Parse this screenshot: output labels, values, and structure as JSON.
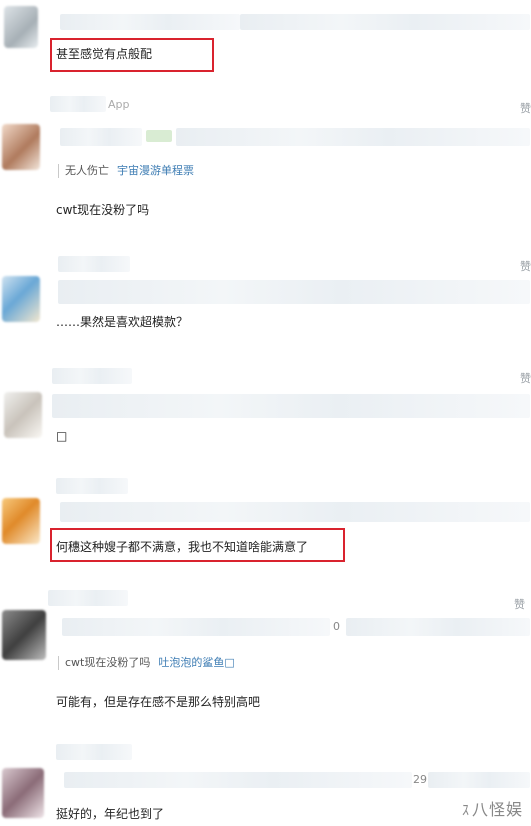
{
  "comments": [
    {
      "text": "甚至感觉有点般配"
    },
    {
      "source": "App",
      "quote_user": "无人伤亡",
      "quote_link": "宇宙漫游单程票",
      "text": "cwt现在没粉了吗"
    },
    {
      "text": "……果然是喜欢超模款？"
    },
    {
      "text": "□"
    },
    {
      "text": "何穗这种嫂子都不满意，我也不知道啥能满意了"
    },
    {
      "meta_tail": "0",
      "quote_user": "cwt现在没粉了吗",
      "quote_link": "吐泡泡的鲨鱼□",
      "text": "可能有，但是存在感不是那么特别高吧"
    },
    {
      "meta_tail": "29",
      "text": "挺好的，年纪也到了"
    }
  ],
  "side_labels": [
    "赞",
    "赞",
    "赞",
    "赞"
  ],
  "watermark": {
    "icon": "ｽ",
    "text": "八怪娱"
  },
  "highlight_color": "#d9232e"
}
